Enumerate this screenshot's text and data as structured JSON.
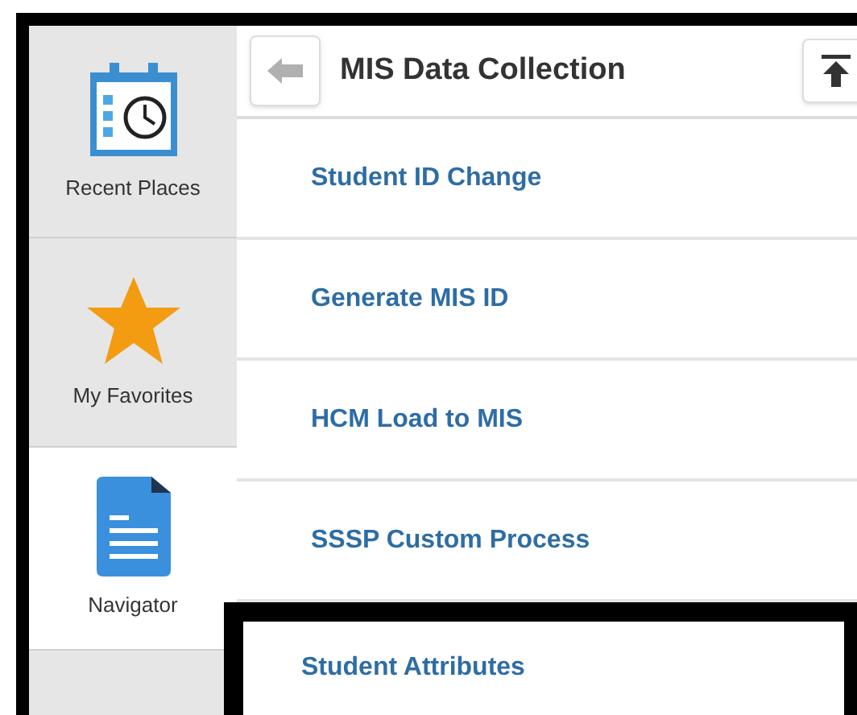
{
  "sidebar": {
    "items": [
      {
        "label": "Recent Places",
        "kind": "recent",
        "selected": false
      },
      {
        "label": "My Favorites",
        "kind": "favorites",
        "selected": false
      },
      {
        "label": "Navigator",
        "kind": "navigator",
        "selected": true
      }
    ]
  },
  "header": {
    "title": "MIS Data Collection"
  },
  "items": [
    {
      "label": "Student ID Change",
      "highlighted": false
    },
    {
      "label": "Generate MIS ID",
      "highlighted": false
    },
    {
      "label": "HCM Load to MIS",
      "highlighted": false
    },
    {
      "label": "SSSP Custom Process",
      "highlighted": false
    },
    {
      "label": "Student Attributes",
      "highlighted": true
    }
  ]
}
